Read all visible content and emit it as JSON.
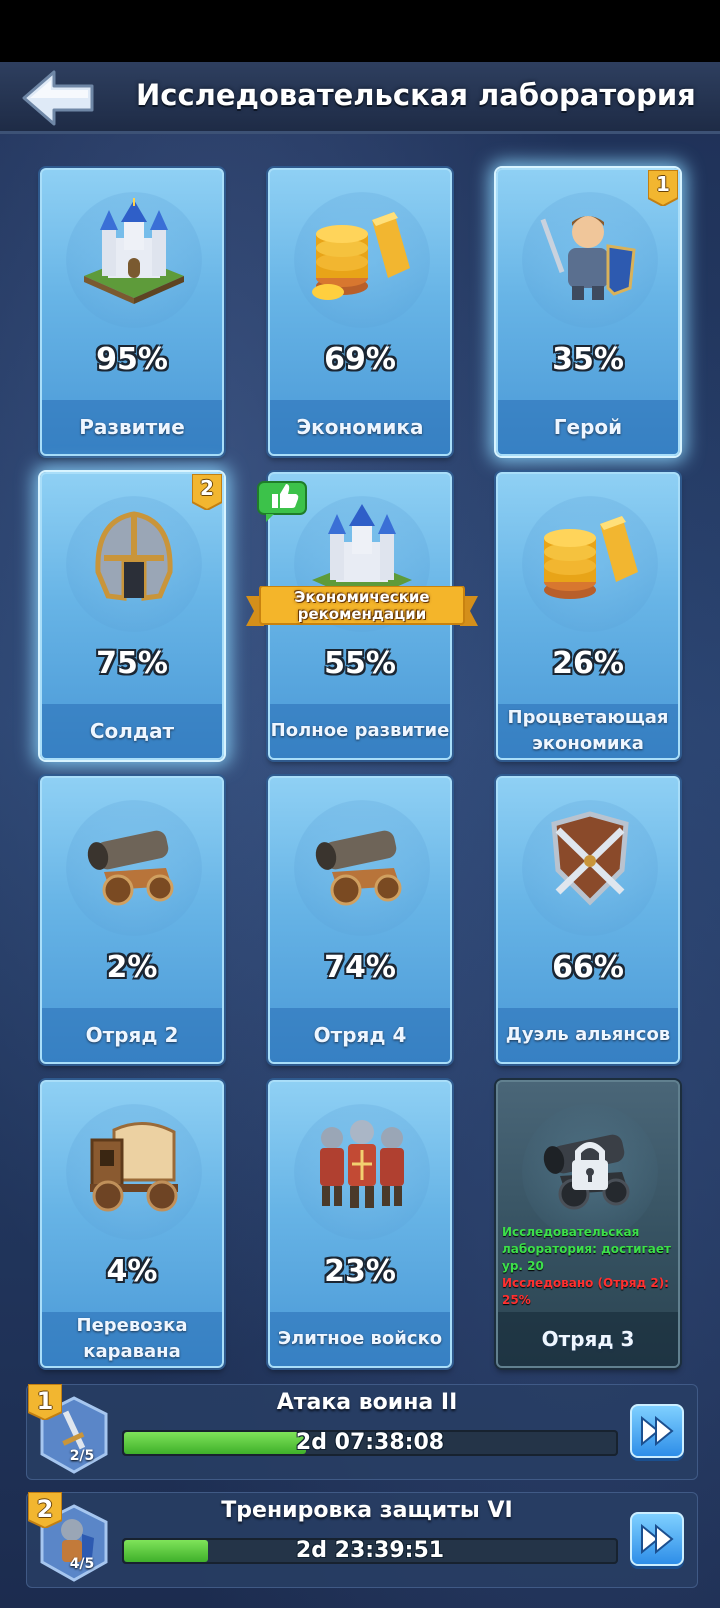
{
  "header": {
    "title": "Исследовательская лаборатория",
    "back_icon": "back-arrow-icon"
  },
  "cards": [
    {
      "icon": "castle-icon",
      "percent": "95%",
      "label": "Развитие"
    },
    {
      "icon": "gold-coins-icon",
      "percent": "69%",
      "label": "Экономика"
    },
    {
      "icon": "knight-hero-icon",
      "percent": "35%",
      "label": "Герой",
      "badge": "1"
    },
    {
      "icon": "helmet-icon",
      "percent": "75%",
      "label": "Солдат",
      "badge": "2"
    },
    {
      "icon": "castle-icon",
      "percent": "55%",
      "label": "Полное развитие",
      "ribbon": "Экономические рекомендации",
      "thumb_icon": "thumbs-up-icon"
    },
    {
      "icon": "gold-coins-icon",
      "percent": "26%",
      "label": "Процветающая экономика"
    },
    {
      "icon": "cannon-icon",
      "percent": "2%",
      "label": "Отряд 2"
    },
    {
      "icon": "cannon-icon",
      "percent": "74%",
      "label": "Отряд 4"
    },
    {
      "icon": "crossed-swords-shield-icon",
      "percent": "66%",
      "label": "Дуэль альянсов"
    },
    {
      "icon": "wagon-icon",
      "percent": "4%",
      "label": "Перевозка каравана"
    },
    {
      "icon": "soldiers-group-icon",
      "percent": "23%",
      "label": "Элитное войско"
    },
    {
      "icon": "locked-cannon-icon",
      "label": "Отряд 3",
      "locked": true,
      "requirement_met": "Исследовательская лаборатория: достигает ур. 20",
      "requirement_unmet": "Исследовано (Отряд 2): 25%"
    }
  ],
  "queue": [
    {
      "slot": "1",
      "level": "2/5",
      "title": "Атака воина II",
      "timer": "2d 07:38:08",
      "progress": 0.37,
      "icon": "warrior-sword-icon"
    },
    {
      "slot": "2",
      "level": "4/5",
      "title": "Тренировка защиты VI",
      "timer": "2d 23:39:51",
      "progress": 0.17,
      "icon": "guard-soldier-icon"
    }
  ],
  "colors": {
    "card_blue": "#67b4e6",
    "locked_card": "#34505f",
    "progress_green": "#3fb02a",
    "requirement_green": "#3ce04a",
    "requirement_red": "#ff3030",
    "badge_gold": "#f2b630"
  }
}
